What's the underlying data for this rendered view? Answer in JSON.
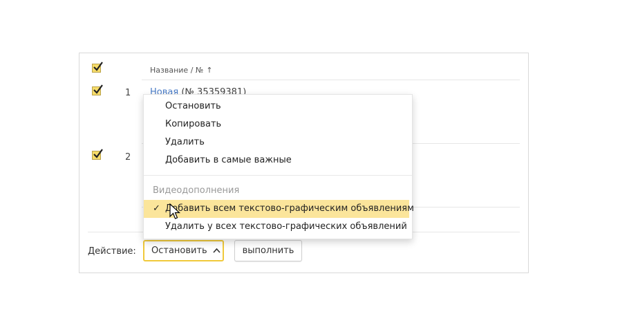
{
  "table": {
    "column_header": "Название / №",
    "sort_arrow": "↑",
    "rows": [
      {
        "number": "1",
        "name_link": "Новая",
        "name_id": "(№ 35359381)",
        "checked": true
      },
      {
        "number": "2",
        "checked": true
      }
    ],
    "header_checked": true
  },
  "footer": {
    "action_label": "Действие:",
    "selected_action": "Остановить",
    "execute_label": "выполнить"
  },
  "menu": {
    "items": [
      {
        "label": "Остановить"
      },
      {
        "label": "Копировать"
      },
      {
        "label": "Удалить"
      },
      {
        "label": "Добавить в самые важные"
      }
    ],
    "group_label": "Видеодополнения",
    "group_items": [
      {
        "label": "Добавить всем текстово-графическим объявлениям",
        "selected": true
      },
      {
        "label": "Удалить у всех текстово-графических объявлений",
        "selected": false
      }
    ],
    "check_mark": "✓"
  },
  "colors": {
    "accent_yellow": "#f0c93a",
    "checkbox_fill": "#f6dc6a",
    "menu_highlight": "#fbe59b",
    "link_blue": "#4a7cc7"
  }
}
